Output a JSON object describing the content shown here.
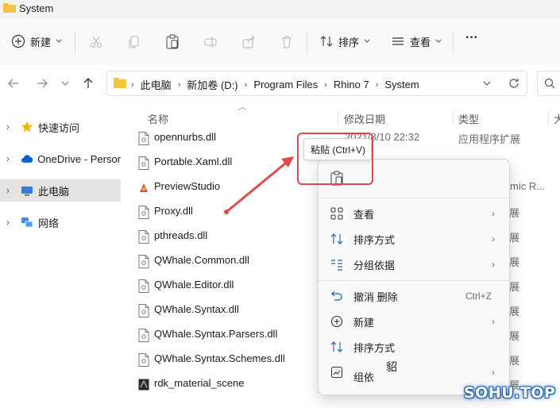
{
  "window": {
    "title": "System"
  },
  "toolbar": {
    "new_label": "新建",
    "sort_label": "排序",
    "view_label": "查看",
    "more_label": "···"
  },
  "address": {
    "crumbs": [
      "此电脑",
      "新加卷 (D:)",
      "Program Files",
      "Rhino 7",
      "System"
    ]
  },
  "sidebar": {
    "items": [
      {
        "label": "快速访问",
        "icon": "star-icon"
      },
      {
        "label": "OneDrive - Persor",
        "icon": "cloud-icon"
      },
      {
        "label": "此电脑",
        "icon": "computer-icon",
        "selected": true
      },
      {
        "label": "网络",
        "icon": "network-icon"
      }
    ]
  },
  "columns": {
    "name": "名称",
    "date": "修改日期",
    "type": "类型",
    "size": "大"
  },
  "files": [
    {
      "name": "opennurbs.dll",
      "date": "2021/8/10 22:32",
      "type": "应用程序扩展",
      "icon": "dll-file-icon"
    },
    {
      "name": "Portable.Xaml.dll",
      "date": "",
      "type": "",
      "icon": "dll-file-icon"
    },
    {
      "name": "PreviewStudio",
      "date": "",
      "type": "",
      "icon": "app-icon"
    },
    {
      "name": "Proxy.dll",
      "date": "",
      "type": "",
      "icon": "dll-file-icon"
    },
    {
      "name": "pthreads.dll",
      "date": "",
      "type": "",
      "icon": "dll-file-icon"
    },
    {
      "name": "QWhale.Common.dll",
      "date": "",
      "type": "",
      "icon": "dll-file-icon"
    },
    {
      "name": "QWhale.Editor.dll",
      "date": "",
      "type": "",
      "icon": "dll-file-icon"
    },
    {
      "name": "QWhale.Syntax.dll",
      "date": "",
      "type": "",
      "icon": "dll-file-icon"
    },
    {
      "name": "QWhale.Syntax.Parsers.dll",
      "date": "",
      "type": "",
      "icon": "dll-file-icon"
    },
    {
      "name": "QWhale.Syntax.Schemes.dll",
      "date": "",
      "type": "",
      "icon": "dll-file-icon"
    },
    {
      "name": "rdk_material_scene",
      "date": "",
      "type": "",
      "icon": "scene-file-icon"
    }
  ],
  "partial_type_labels": [
    "mic R...",
    "展",
    "展",
    "展",
    "展",
    "展",
    "展",
    "展",
    "展"
  ],
  "context_menu": {
    "items": [
      {
        "label": "查看",
        "icon": "grid-icon",
        "arrow": "›"
      },
      {
        "label": "排序方式",
        "icon": "sort-icon",
        "arrow": "›"
      },
      {
        "label": "分组依据",
        "icon": "group-icon",
        "arrow": "›"
      },
      {
        "label": "撤消 删除",
        "icon": "undo-icon",
        "shortcut": "Ctrl+Z"
      },
      {
        "label": "新建",
        "icon": "new-icon",
        "arrow": "›"
      },
      {
        "label": "排序方式",
        "icon": "sort-icon",
        "arrow": ""
      },
      {
        "label": "组依",
        "icon": "group-icon",
        "arrow": "›"
      }
    ],
    "overlap_char": "貂"
  },
  "tooltip": {
    "text": "粘贴 (Ctrl+V)"
  },
  "watermark": "SOHU.TOP",
  "colors": {
    "accent": "#0067c0",
    "annotation": "#e24a4a",
    "folder": "#f6c244"
  }
}
